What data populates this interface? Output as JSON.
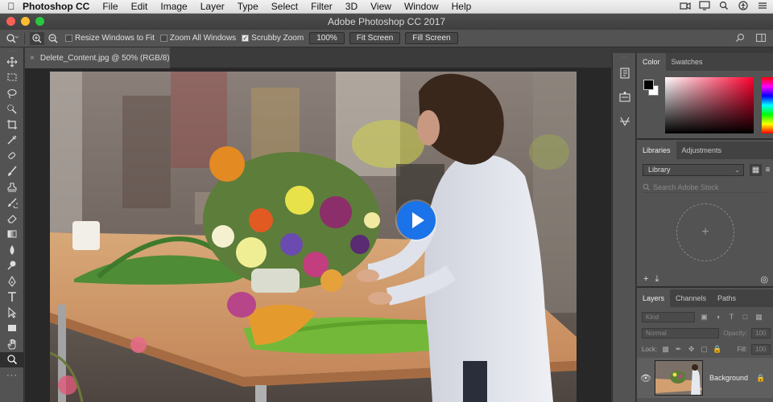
{
  "menubar": {
    "app_name": "Photoshop CC",
    "items": [
      "File",
      "Edit",
      "Image",
      "Layer",
      "Type",
      "Select",
      "Filter",
      "3D",
      "View",
      "Window",
      "Help"
    ]
  },
  "window": {
    "title": "Adobe Photoshop CC 2017"
  },
  "options": {
    "resize_windows": "Resize Windows to Fit",
    "zoom_all": "Zoom All Windows",
    "scrubby": "Scrubby Zoom",
    "zoom_value": "100%",
    "fit_screen": "Fit Screen",
    "fill_screen": "Fill Screen"
  },
  "document": {
    "tab_title": "Delete_Content.jpg @ 50% (RGB/8)"
  },
  "panels": {
    "color": {
      "tab_color": "Color",
      "tab_swatches": "Swatches",
      "accent": "#ff0030"
    },
    "libraries": {
      "tab_libraries": "Libraries",
      "tab_adjustments": "Adjustments",
      "library_select": "Library",
      "search_placeholder": "Search Adobe Stock",
      "add_symbol": "+"
    },
    "layers": {
      "tab_layers": "Layers",
      "tab_channels": "Channels",
      "tab_paths": "Paths",
      "kind": "Kind",
      "blend": "Normal",
      "opacity_label": "Opacity:",
      "opacity_value": "100",
      "lock_label": "Lock:",
      "fill_label": "Fill:",
      "fill_value": "100",
      "layer_name": "Background"
    }
  },
  "video": {
    "play_color": "#1a73e8"
  }
}
